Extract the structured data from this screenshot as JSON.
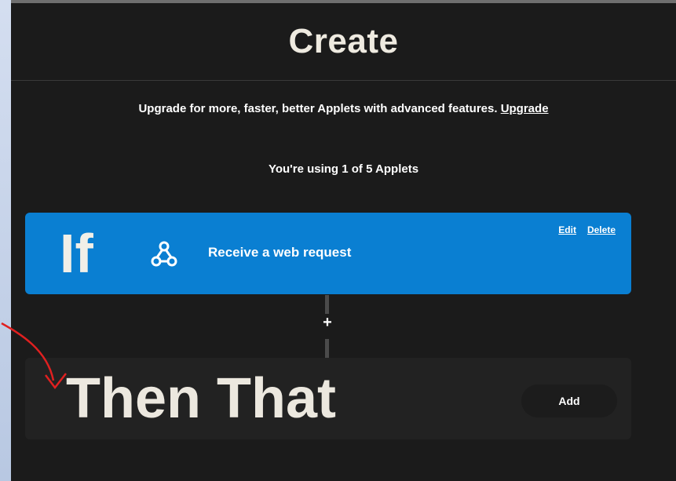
{
  "header": {
    "title": "Create"
  },
  "upgrade": {
    "text": "Upgrade for more, faster, better Applets with advanced features.",
    "link_label": "Upgrade"
  },
  "usage": {
    "text": "You're using 1 of 5 Applets"
  },
  "trigger": {
    "keyword": "If",
    "icon": "webhook-icon",
    "label": "Receive a web request",
    "edit_label": "Edit",
    "delete_label": "Delete",
    "color": "#0a7fd2"
  },
  "connector": {
    "plus_label": "+"
  },
  "action": {
    "keyword": "Then That",
    "add_label": "Add"
  }
}
